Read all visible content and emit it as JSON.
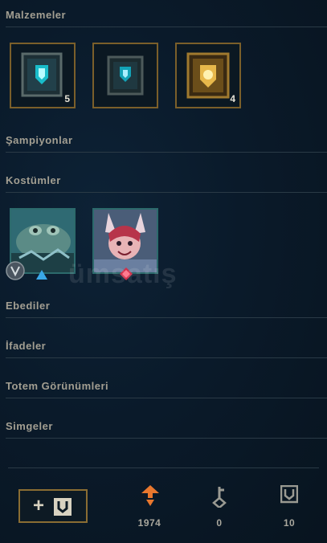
{
  "sections": {
    "materials": "Malzemeler",
    "champions": "Şampiyonlar",
    "skins": "Kostümler",
    "eternals": "Ebediler",
    "emotes": "İfadeler",
    "wards": "Totem Görünümleri",
    "icons": "Simgeler"
  },
  "materials": [
    {
      "icon": "hextech-chest-icon",
      "count": "5"
    },
    {
      "icon": "hextech-chest-icon",
      "count": ""
    },
    {
      "icon": "masterwork-chest-icon",
      "count": "4"
    }
  ],
  "skins": [
    {
      "icon": "toad-champion-skin",
      "gem": "blue"
    },
    {
      "icon": "bunny-champion-skin",
      "gem": "red"
    }
  ],
  "footer": {
    "orange_essence": "1974",
    "keys": "0",
    "chests": "10"
  },
  "watermark": "ümsatış",
  "colors": {
    "gold": "#7b5f2a",
    "teal": "#2c6a6c",
    "essence": "#e8772e"
  }
}
